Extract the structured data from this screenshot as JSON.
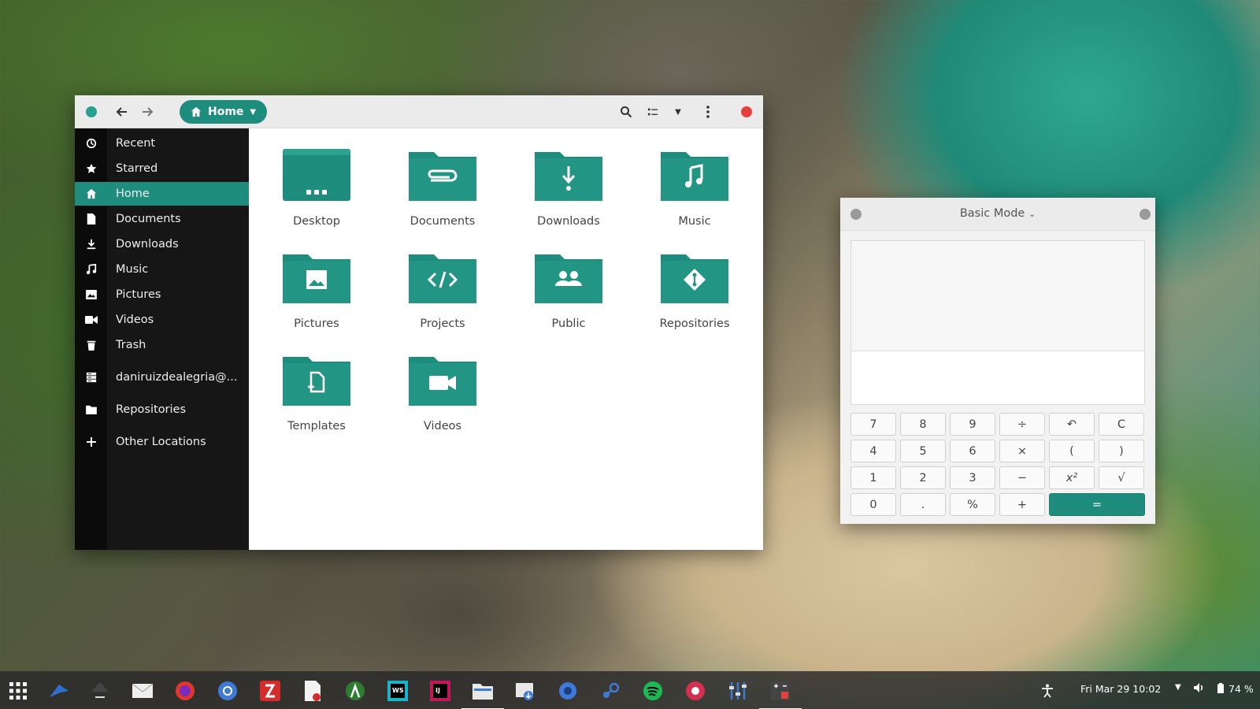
{
  "file_manager": {
    "path_button_label": "Home",
    "sidebar": {
      "items": [
        {
          "label": "Recent",
          "icon": "clock-icon"
        },
        {
          "label": "Starred",
          "icon": "star-icon"
        },
        {
          "label": "Home",
          "icon": "home-icon",
          "active": true
        },
        {
          "label": "Documents",
          "icon": "document-icon"
        },
        {
          "label": "Downloads",
          "icon": "download-icon"
        },
        {
          "label": "Music",
          "icon": "music-note-icon"
        },
        {
          "label": "Pictures",
          "icon": "picture-icon"
        },
        {
          "label": "Videos",
          "icon": "video-camera-icon"
        },
        {
          "label": "Trash",
          "icon": "trash-icon"
        },
        {
          "label": "daniruizdealegria@...",
          "icon": "network-server-icon"
        },
        {
          "label": "Repositories",
          "icon": "folder-icon"
        },
        {
          "label": "Other Locations",
          "icon": "plus-icon"
        }
      ]
    },
    "folders": [
      {
        "label": "Desktop",
        "icon": "desktop-folder-icon"
      },
      {
        "label": "Documents",
        "icon": "paperclip-folder-icon"
      },
      {
        "label": "Downloads",
        "icon": "download-folder-icon"
      },
      {
        "label": "Music",
        "icon": "music-folder-icon"
      },
      {
        "label": "Pictures",
        "icon": "picture-folder-icon"
      },
      {
        "label": "Projects",
        "icon": "code-folder-icon"
      },
      {
        "label": "Public",
        "icon": "people-folder-icon"
      },
      {
        "label": "Repositories",
        "icon": "git-folder-icon"
      },
      {
        "label": "Templates",
        "icon": "template-folder-icon"
      },
      {
        "label": "Videos",
        "icon": "video-folder-icon"
      }
    ]
  },
  "calculator": {
    "title": "Basic Mode",
    "display_value": "",
    "buttons": {
      "b7": "7",
      "b8": "8",
      "b9": "9",
      "div": "÷",
      "undo": "↶",
      "clear": "C",
      "b4": "4",
      "b5": "5",
      "b6": "6",
      "mul": "×",
      "lparen": "(",
      "rparen": ")",
      "b1": "1",
      "b2": "2",
      "b3": "3",
      "sub": "−",
      "square": "x²",
      "sqrt": "√",
      "b0": "0",
      "dot": ".",
      "percent": "%",
      "add": "+",
      "equals": "="
    }
  },
  "taskbar": {
    "datetime": "Fri Mar 29  10:02",
    "battery": "74 %"
  },
  "colors": {
    "accent": "#1e8d7e",
    "folder": "#1e8d7e",
    "close": "#e53f3f"
  }
}
